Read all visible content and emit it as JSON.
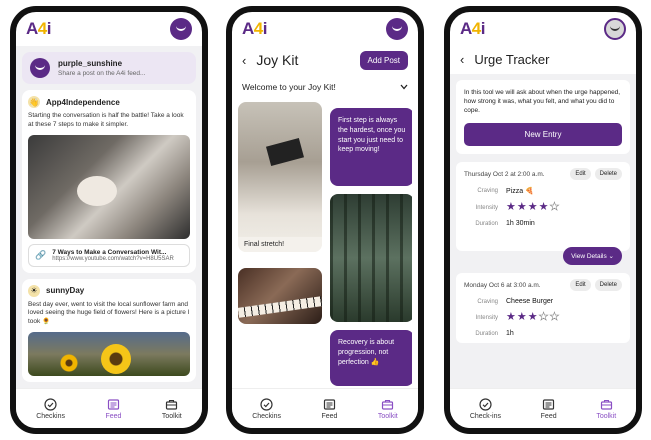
{
  "logo": {
    "prefix": "A",
    "num": "4",
    "suffix": "i"
  },
  "nav": {
    "checkins": "Checkins",
    "checkins_alt": "Check-ins",
    "feed": "Feed",
    "toolkit": "Toolkit"
  },
  "feed": {
    "share": {
      "username": "purple_sunshine",
      "subtitle": "Share a post on the A4i feed..."
    },
    "posts": [
      {
        "user": "App4Independence",
        "avatar_emoji": "👋",
        "text": "Starting the conversation is half the battle! Take a look at these 7 steps to make it simpler.",
        "link_title": "7 Ways to Make a Conversation Wit...",
        "link_url": "https://www.youtube.com/watch?v=H8U5SAR"
      },
      {
        "user": "sunnyDay",
        "avatar_emoji": "☀",
        "text": "Best day ever, went to visit the local sunflower farm and loved seeing the huge field of flowers! Here is a picture I took 🌻"
      }
    ]
  },
  "joykit": {
    "title": "Joy Kit",
    "add_post": "Add Post",
    "welcome": "Welcome to your Joy Kit!",
    "caption_building": "Final stretch!",
    "text_1": "First step is always the hardest, once you start you just need to keep moving!",
    "text_2": "Recovery is about progression, not perfection 👍"
  },
  "urge": {
    "title": "Urge Tracker",
    "intro": "In this tool we will ask about when the urge happened, how strong it was, what you felt, and what you did to cope.",
    "new_entry": "New Entry",
    "edit": "Edit",
    "delete": "Delete",
    "label_craving": "Craving",
    "label_intensity": "Intensity",
    "label_duration": "Duration",
    "view_details": "View Details",
    "entries": [
      {
        "date": "Thursday Oct 2 at 2:00 a.m.",
        "craving": "Pizza 🍕",
        "intensity": 4,
        "duration": "1h 30min"
      },
      {
        "date": "Monday Oct 6 at 3:00 a.m.",
        "craving": "Cheese Burger",
        "intensity": 3,
        "duration": "1h"
      }
    ]
  },
  "colors": {
    "primary": "#5b2a86",
    "accent": "#f1b400",
    "active_tab": "#8a4fc4"
  }
}
